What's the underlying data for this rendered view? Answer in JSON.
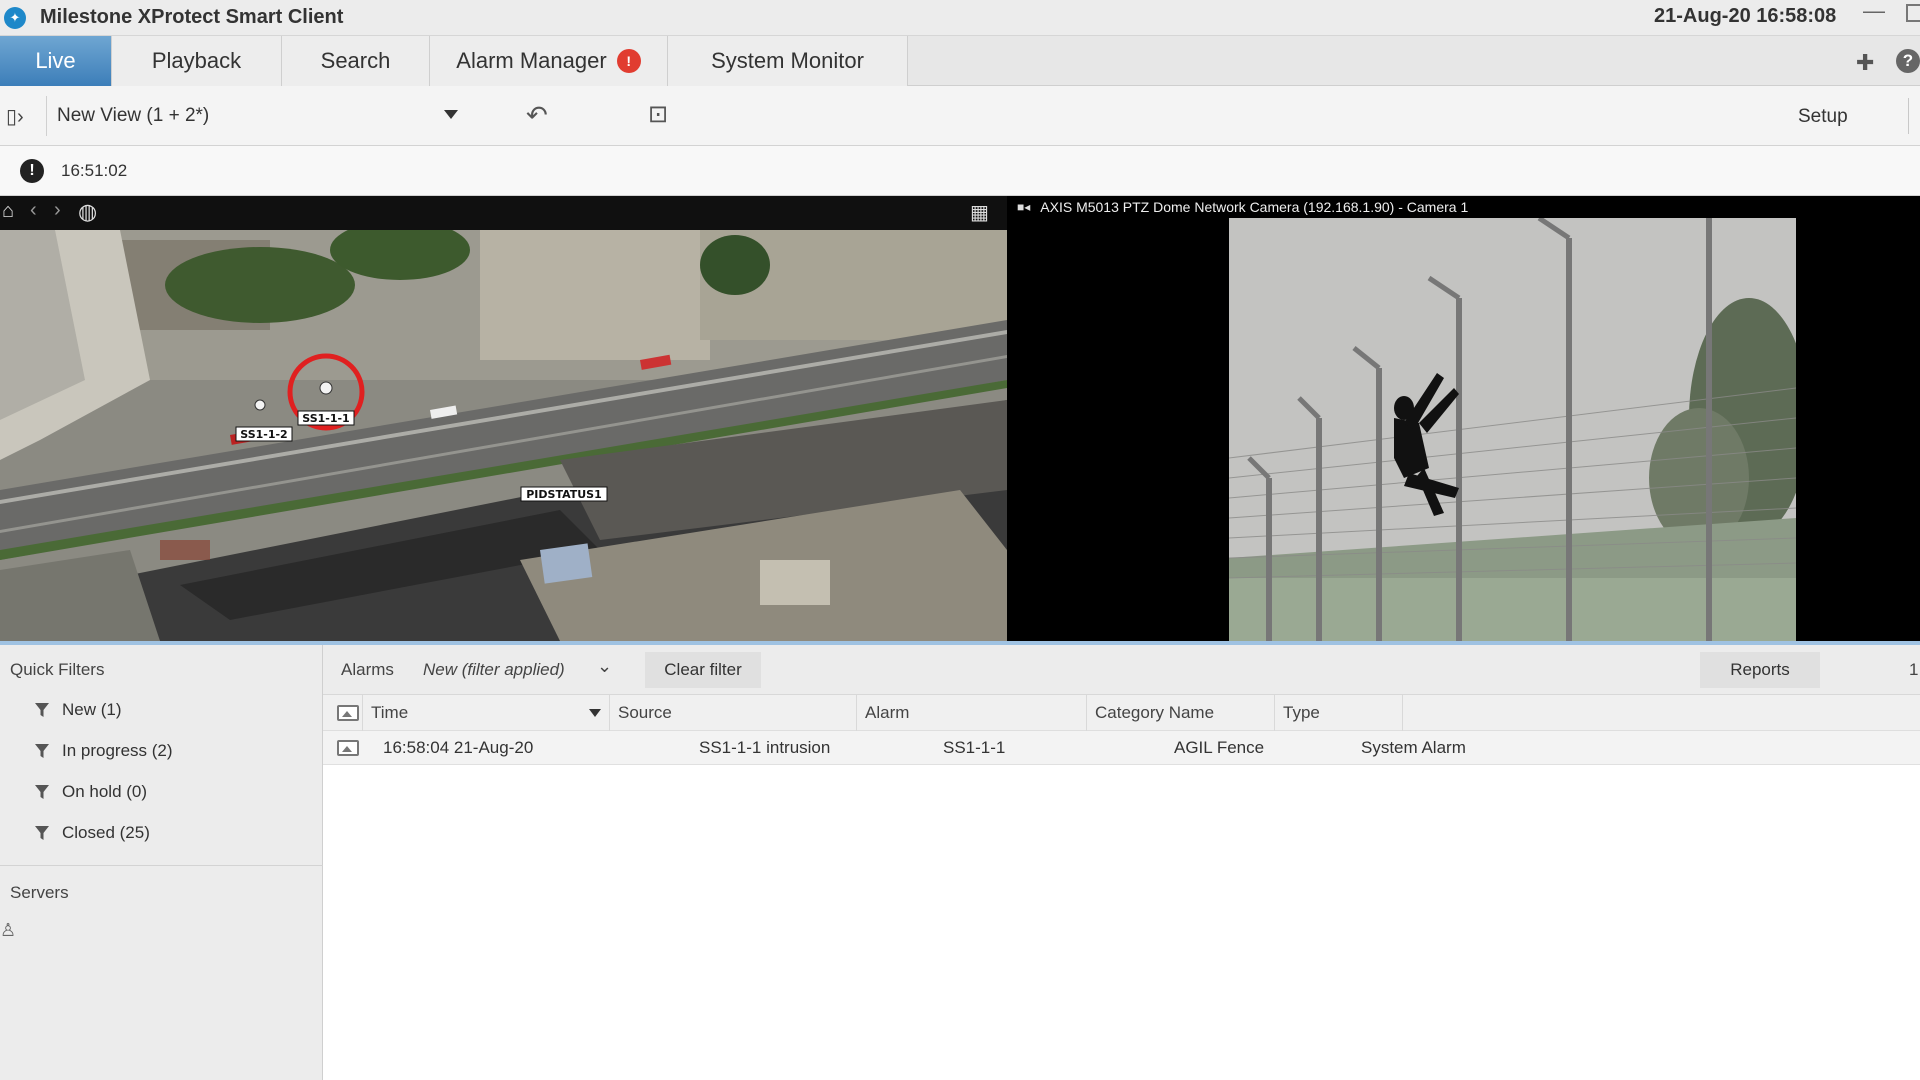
{
  "app": {
    "title": "Milestone XProtect Smart Client",
    "datetime": "21-Aug-20 16:58:08",
    "logo_icon": "xprotect-logo-icon"
  },
  "tabs": [
    {
      "label": "Live",
      "active": true
    },
    {
      "label": "Playback"
    },
    {
      "label": "Search"
    },
    {
      "label": "Alarm Manager",
      "badge": "!"
    },
    {
      "label": "System Monitor"
    }
  ],
  "toolbar": {
    "view_name": "New View (1 + 2*)",
    "setup_label": "Setup"
  },
  "infobar": {
    "time": "16:51:02"
  },
  "map": {
    "markers": [
      {
        "label": "SS1-1-1"
      },
      {
        "label": "SS1-1-2"
      },
      {
        "label": "PIDSTATUS1"
      }
    ]
  },
  "camera": {
    "title": "AXIS M5013 PTZ Dome Network Camera (192.168.1.90) - Camera 1"
  },
  "quick_filters": {
    "title": "Quick Filters",
    "items": [
      {
        "label": "New (1)"
      },
      {
        "label": "In progress (2)"
      },
      {
        "label": "On hold (0)"
      },
      {
        "label": "Closed (25)"
      }
    ],
    "servers_title": "Servers"
  },
  "alarm_list": {
    "label": "Alarms",
    "filter": "New (filter applied)",
    "clear_filter": "Clear filter",
    "reports": "Reports",
    "paging": "1",
    "columns": [
      "Time",
      "Source",
      "Alarm",
      "Category Name",
      "Type"
    ],
    "rows": [
      {
        "time": "16:58:04 21-Aug-20",
        "source": "SS1-1-1 intrusion",
        "alarm": "SS1-1-1",
        "category": "AGIL Fence",
        "type": "System Alarm"
      }
    ]
  },
  "colors": {
    "active_tab": "#4a8ac3",
    "alarm_badge": "#e13c30",
    "marker_ring": "#e02020"
  }
}
